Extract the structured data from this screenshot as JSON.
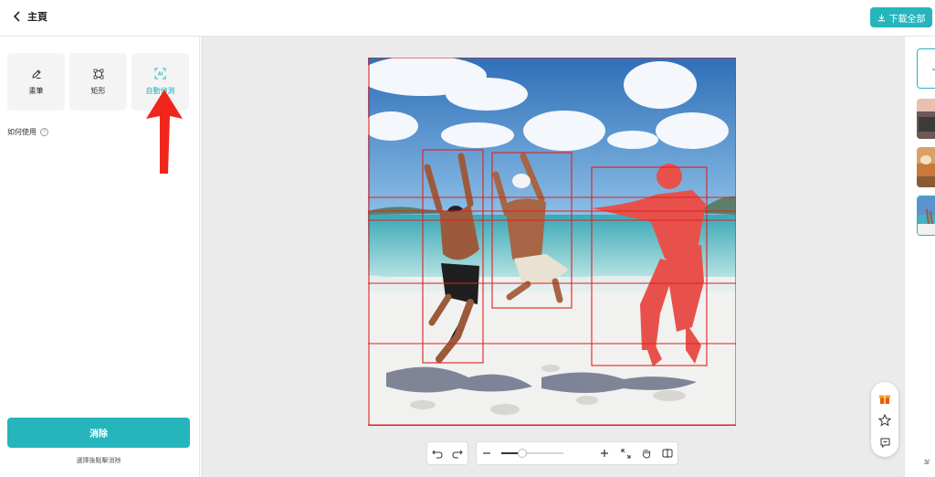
{
  "header": {
    "back_label": "主頁",
    "download_label": "下載全部"
  },
  "tools": [
    {
      "label": "畫筆",
      "icon": "pen-icon"
    },
    {
      "label": "矩形",
      "icon": "rectangle-icon"
    },
    {
      "label": "自動偵測",
      "icon": "ai-detect-icon",
      "badge": "AI",
      "active": true
    }
  ],
  "how_to_use": "如何使用",
  "help_glyph": "?",
  "erase_button": "消除",
  "erase_hint": "選擇後點擊消除",
  "page_counter": "3/",
  "colors": {
    "accent": "#26b5bd",
    "detection": "#e02020",
    "arrow": "#f0261c"
  }
}
